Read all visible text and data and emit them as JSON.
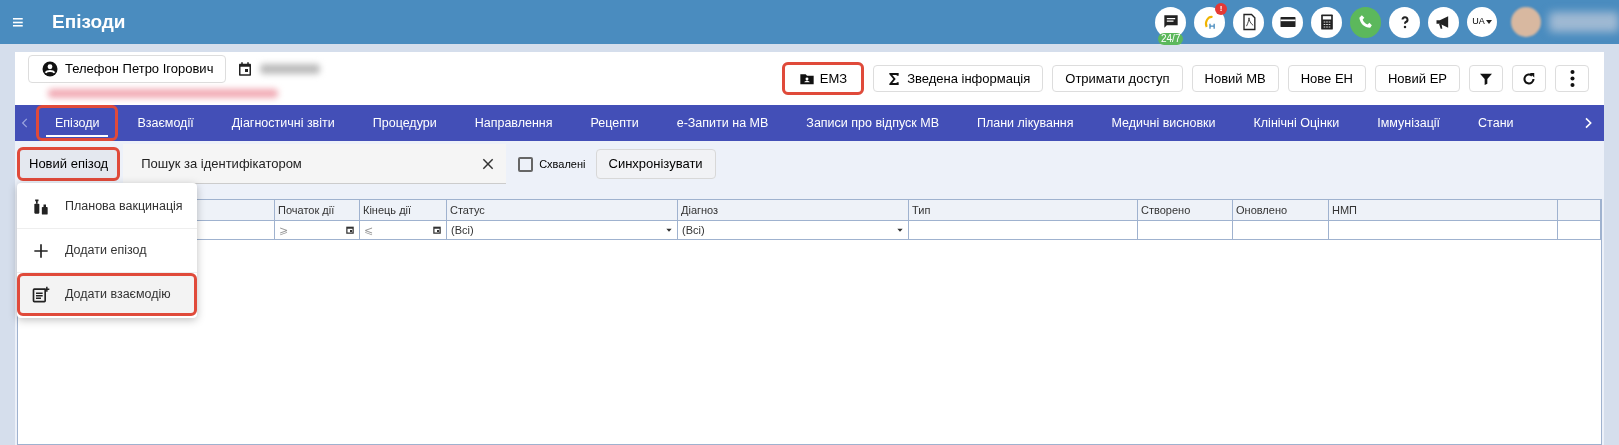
{
  "header": {
    "menu_glyph": "≡",
    "title": "Епізоди",
    "icons": [
      {
        "kind": "chat",
        "badge": "24/7"
      },
      {
        "kind": "eh",
        "alert": "!"
      },
      {
        "kind": "pdf"
      },
      {
        "kind": "card"
      },
      {
        "kind": "calc"
      },
      {
        "kind": "phone"
      },
      {
        "kind": "help"
      },
      {
        "kind": "megaphone"
      },
      {
        "kind": "lang",
        "label": "UA"
      }
    ]
  },
  "patient": {
    "name": "Телефон Петро Ігорович"
  },
  "actions": [
    {
      "kind": "emz",
      "label": "ЕМЗ",
      "highlighted": true
    },
    {
      "kind": "sigma",
      "label": "Зведена інформація",
      "highlighted": false
    },
    {
      "kind": "text",
      "label": "Отримати доступ",
      "highlighted": false
    },
    {
      "kind": "text",
      "label": "Новий МВ",
      "highlighted": false
    },
    {
      "kind": "text",
      "label": "Нове ЕН",
      "highlighted": false
    },
    {
      "kind": "text",
      "label": "Новий ЕР",
      "highlighted": false
    },
    {
      "kind": "filter",
      "highlighted": false
    },
    {
      "kind": "refresh",
      "highlighted": false
    },
    {
      "kind": "more",
      "highlighted": false
    }
  ],
  "tabs": [
    {
      "label": "Епізоди",
      "selected": true,
      "highlighted": true
    },
    {
      "label": "Взаємодії",
      "selected": false,
      "highlighted": false
    },
    {
      "label": "Діагностичні звіти",
      "selected": false,
      "highlighted": false
    },
    {
      "label": "Процедури",
      "selected": false,
      "highlighted": false
    },
    {
      "label": "Направлення",
      "selected": false,
      "highlighted": false
    },
    {
      "label": "Рецепти",
      "selected": false,
      "highlighted": false
    },
    {
      "label": "е-Запити на МВ",
      "selected": false,
      "highlighted": false
    },
    {
      "label": "Записи про відпуск МВ",
      "selected": false,
      "highlighted": false
    },
    {
      "label": "Плани лікування",
      "selected": false,
      "highlighted": false
    },
    {
      "label": "Медичні висновки",
      "selected": false,
      "highlighted": false
    },
    {
      "label": "Клінічні Оцінки",
      "selected": false,
      "highlighted": false
    },
    {
      "label": "Іммунізації",
      "selected": false,
      "highlighted": false
    },
    {
      "label": "Стани",
      "selected": false,
      "highlighted": false
    }
  ],
  "toolbar": {
    "new_button": {
      "label": "Новий епізод",
      "highlighted": true
    },
    "search": {
      "placeholder": "Пошук за ідентифікатором"
    },
    "approved": {
      "label": "Схвалені",
      "checked": false
    },
    "sync": {
      "label": "Синхронізувати"
    }
  },
  "menu": [
    {
      "kind": "vaccine",
      "label": "Планова вакцинація",
      "highlighted": false
    },
    {
      "kind": "plus",
      "label": "Додати епізод",
      "highlighted": false
    },
    {
      "kind": "note",
      "label": "Додати взаємодію",
      "highlighted": true
    }
  ],
  "table": {
    "columns": [
      {
        "kind": "plain"
      },
      {
        "label": "Початок дії",
        "kind": "date",
        "filter_text": "⩾"
      },
      {
        "label": "Кінець дії",
        "kind": "date",
        "filter_text": "⩽"
      },
      {
        "label": "Статус",
        "kind": "select",
        "filter_text": "(Всі)"
      },
      {
        "label": "Діагноз",
        "kind": "select",
        "filter_text": "(Всі)"
      },
      {
        "label": "Тип",
        "kind": "plain"
      },
      {
        "label": "Створено",
        "kind": "plain"
      },
      {
        "label": "Оновлено",
        "kind": "plain"
      },
      {
        "label": "НМП",
        "kind": "plain"
      },
      {
        "kind": "plain"
      }
    ]
  }
}
